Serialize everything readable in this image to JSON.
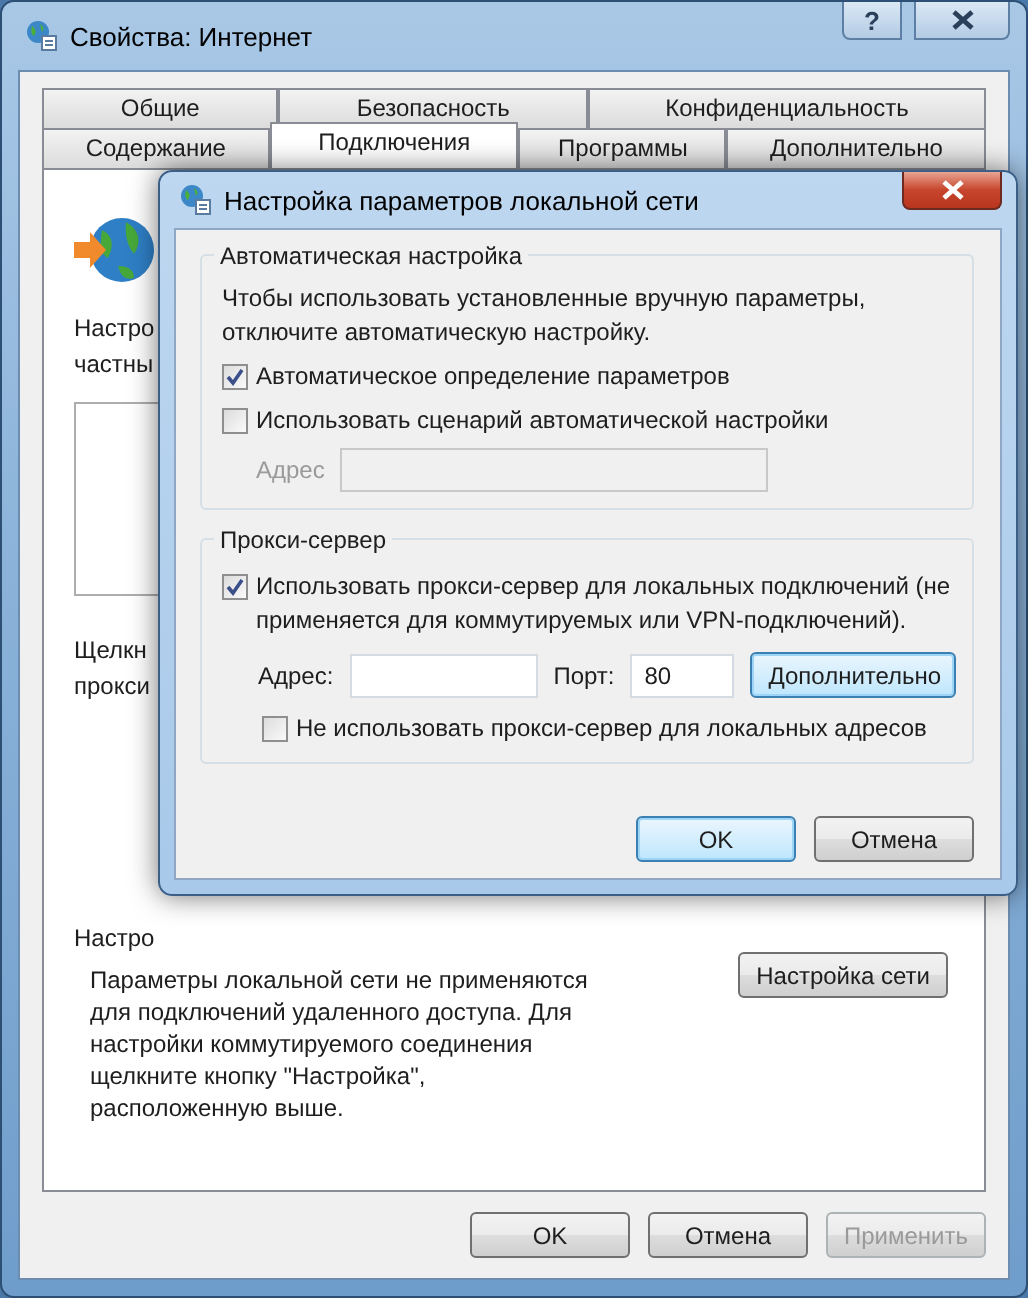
{
  "window": {
    "title": "Свойства: Интернет",
    "help_button": "?"
  },
  "tab_rows": [
    {
      "tabs": [
        {
          "label": "Общие",
          "selected": false
        },
        {
          "label": "Безопасность",
          "selected": false
        },
        {
          "label": "Конфиденциальность",
          "selected": false
        }
      ]
    },
    {
      "tabs": [
        {
          "label": "Содержание",
          "selected": false
        },
        {
          "label": "Подключения",
          "selected": true
        },
        {
          "label": "Программы",
          "selected": false
        },
        {
          "label": "Дополнительно",
          "selected": false
        }
      ]
    }
  ],
  "connections_page": {
    "setup_text": [
      "Настро",
      "частны"
    ],
    "click_text": [
      "Щелкн",
      "прокси"
    ],
    "lan_heading": "Настро",
    "lan_note": [
      "Параметры локальной сети не применяются",
      "для подключений удаленного доступа. Для",
      "настройки коммутируемого соединения",
      "щелкните кнопку \"Настройка\",",
      "расположенную выше."
    ],
    "lan_button": "Настройка сети"
  },
  "buttons": [
    {
      "label": "OK",
      "disabled": false
    },
    {
      "label": "Отмена",
      "disabled": false
    },
    {
      "label": "Применить",
      "disabled": true
    }
  ],
  "dialog": {
    "title": "Настройка параметров локальной сети",
    "auto_group": {
      "legend": "Автоматическая настройка",
      "hint": [
        "Чтобы использовать установленные вручную параметры,",
        "отключите автоматическую настройку."
      ],
      "options": [
        {
          "label": "Автоматическое определение параметров",
          "checked": true
        },
        {
          "label": "Использовать сценарий автоматической настройки",
          "checked": false
        }
      ],
      "address_label": "Адрес",
      "address_disabled": true
    },
    "proxy_group": {
      "legend": "Прокси-сервер",
      "use_proxy": {
        "label": [
          "Использовать прокси-сервер для локальных подключений (не",
          "применяется для коммутируемых или VPN-подключений)."
        ],
        "checked": true
      },
      "address_label": "Адрес:",
      "port_label": "Порт:",
      "port_value": "80",
      "advanced_button": "Дополнительно",
      "bypass": {
        "label": "Не использовать прокси-сервер для локальных адресов",
        "checked": false
      }
    },
    "buttons": [
      {
        "label": "OK",
        "default": true
      },
      {
        "label": "Отмена",
        "default": false
      }
    ]
  }
}
